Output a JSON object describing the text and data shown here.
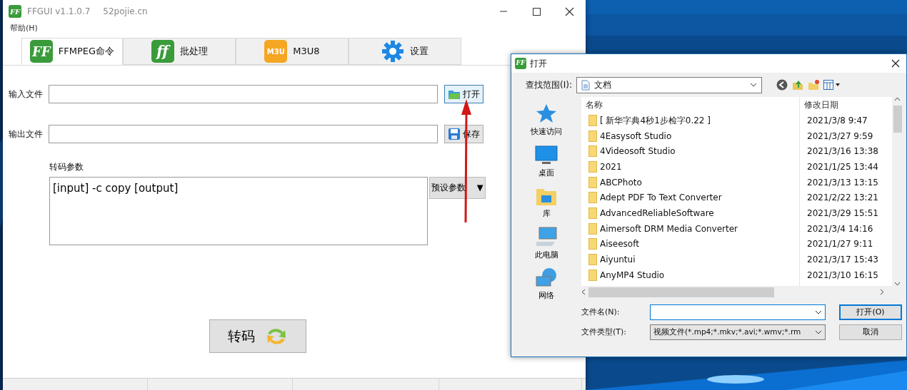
{
  "main_window": {
    "title": "FFGUI v1.1.0.7",
    "site": "52pojie.cn",
    "app_icon_text": "FF",
    "menu": [
      "帮助(H)"
    ],
    "tabs": [
      {
        "label": "FFMPEG命令",
        "selected": true,
        "kind": "ff",
        "icon_text": "FF"
      },
      {
        "label": "批处理",
        "selected": false,
        "kind": "batch",
        "icon_text": "ff"
      },
      {
        "label": "M3U8",
        "selected": false,
        "kind": "m3u",
        "icon_text": "M3U"
      },
      {
        "label": "设置",
        "selected": false,
        "kind": "settings"
      }
    ],
    "input_file": {
      "label": "输入文件",
      "button": "打开"
    },
    "output_file": {
      "label": "输出文件",
      "button": "保存"
    },
    "params": {
      "label": "转码参数",
      "value": "[input] -c copy [output]",
      "preset_button": "预设参数 ▼"
    },
    "convert_button": "转码"
  },
  "open_dialog": {
    "title": "打开",
    "app_icon_text": "FF",
    "look_in_label": "查找范围(I):",
    "look_in_value": "文档",
    "places": [
      {
        "label": "快速访问",
        "kind": "quick"
      },
      {
        "label": "桌面",
        "kind": "desktop"
      },
      {
        "label": "库",
        "kind": "library"
      },
      {
        "label": "此电脑",
        "kind": "pc"
      },
      {
        "label": "网络",
        "kind": "network"
      }
    ],
    "columns": [
      "名称",
      "修改日期"
    ],
    "files": [
      {
        "name": "[ 新华字典4秒1步检字0.22 ]",
        "modified": "2021/3/8 9:47"
      },
      {
        "name": "4Easysoft Studio",
        "modified": "2021/3/27 9:59"
      },
      {
        "name": "4Videosoft Studio",
        "modified": "2021/3/16 13:38"
      },
      {
        "name": "2021",
        "modified": "2021/1/25 13:44"
      },
      {
        "name": "ABCPhoto",
        "modified": "2021/3/13 13:15"
      },
      {
        "name": "Adept PDF To Text Converter",
        "modified": "2021/2/22 13:21"
      },
      {
        "name": "AdvancedReliableSoftware",
        "modified": "2021/3/29 15:51"
      },
      {
        "name": "Aimersoft DRM Media Converter",
        "modified": "2021/3/4 14:16"
      },
      {
        "name": "Aiseesoft",
        "modified": "2021/1/27 9:11"
      },
      {
        "name": "Aiyuntui",
        "modified": "2021/3/17 15:43"
      },
      {
        "name": "AnyMP4 Studio",
        "modified": "2021/3/10 16:15"
      }
    ],
    "file_name_label": "文件名(N):",
    "file_type_label": "文件类型(T):",
    "file_type_value": "视频文件(*.mp4;*.mkv;*.avi;*.wmv;*.rm",
    "open_button": "打开(O)",
    "cancel_button": "取消"
  }
}
